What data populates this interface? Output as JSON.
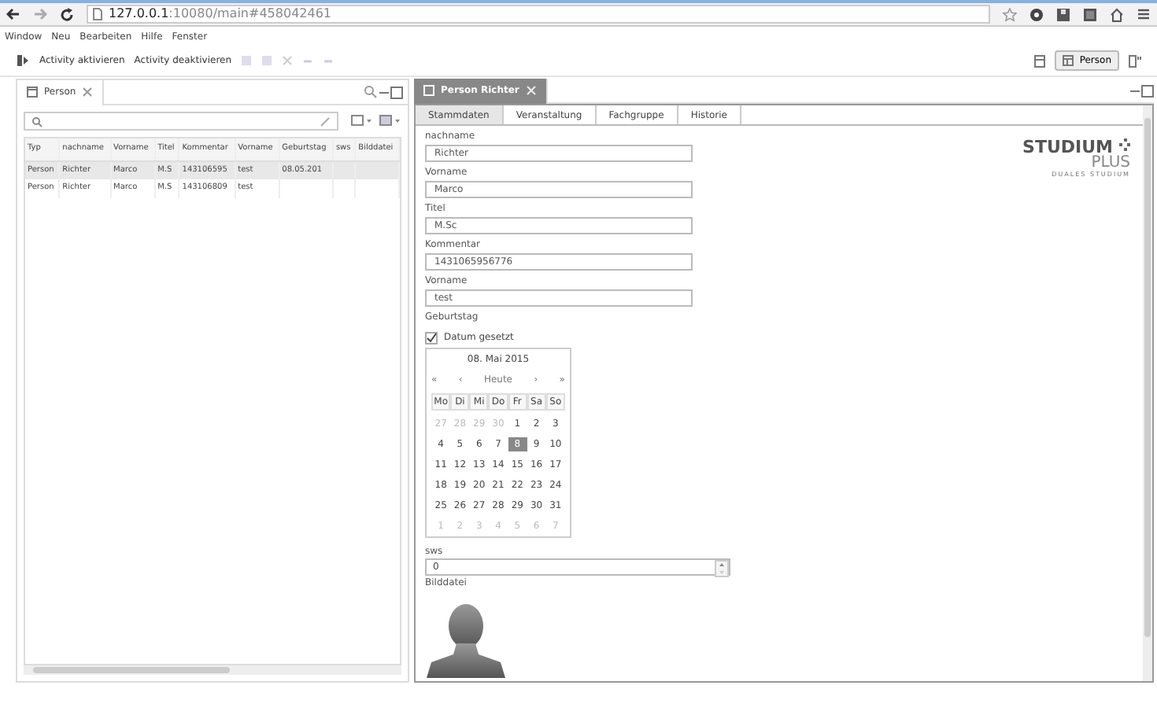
{
  "browser": {
    "url_host": "127.0.0.1",
    "url_rest": ":10080/main#458042461"
  },
  "menu": [
    "Window",
    "Neu",
    "Bearbeiten",
    "Hilfe",
    "Fenster"
  ],
  "toolbar": {
    "actions": [
      {
        "label": "Activity aktivieren",
        "disabled": false
      },
      {
        "label": "Activity deaktivieren",
        "disabled": false
      }
    ],
    "perspective": "Person"
  },
  "left_panel": {
    "tab": "Person",
    "table": {
      "columns": [
        "Typ",
        "nachname",
        "Vorname",
        "Titel",
        "Kommentar",
        "Vorname",
        "Geburtstag",
        "sws",
        "Bilddatei"
      ],
      "rows": [
        {
          "selected": true,
          "cells": [
            "Person",
            "Richter",
            "Marco",
            "M.S",
            "143106595",
            "test",
            "08.05.201",
            "",
            ""
          ]
        },
        {
          "selected": false,
          "cells": [
            "Person",
            "Richter",
            "Marco",
            "M.S",
            "143106809",
            "test",
            "",
            "",
            ""
          ]
        }
      ]
    }
  },
  "right_panel": {
    "tab": "Person Richter",
    "subtabs": [
      {
        "label": "Stammdaten",
        "selected": true
      },
      {
        "label": "Veranstaltung",
        "selected": false
      },
      {
        "label": "Fachgruppe",
        "selected": false
      },
      {
        "label": "Historie",
        "selected": false
      }
    ],
    "logo": {
      "line1": "STUDIUM",
      "line2": "PLUS",
      "line3": "DUALES STUDIUM"
    },
    "fields": [
      {
        "label": "nachname",
        "value": "Richter"
      },
      {
        "label": "Vorname",
        "value": "Marco"
      },
      {
        "label": "Titel",
        "value": "M.Sc"
      },
      {
        "label": "Kommentar",
        "value": "1431065956776"
      },
      {
        "label": "Vorname",
        "value": "test"
      }
    ],
    "birthday": {
      "label": "Geburtstag",
      "checkbox": {
        "label": "Datum gesetzt",
        "checked": true
      },
      "calendar": {
        "title": "08. Mai 2015",
        "nav": [
          "«",
          "‹",
          "Heute",
          "›",
          "»"
        ],
        "weekdays": [
          "Mo",
          "Di",
          "Mi",
          "Do",
          "Fr",
          "Sa",
          "So"
        ],
        "weeks": [
          [
            {
              "d": "27",
              "muted": true,
              "selected": false
            },
            {
              "d": "28",
              "muted": true,
              "selected": false
            },
            {
              "d": "29",
              "muted": true,
              "selected": false
            },
            {
              "d": "30",
              "muted": true,
              "selected": false
            },
            {
              "d": "1",
              "muted": false,
              "selected": false
            },
            {
              "d": "2",
              "muted": false,
              "selected": false
            },
            {
              "d": "3",
              "muted": false,
              "selected": false
            }
          ],
          [
            {
              "d": "4",
              "muted": false,
              "selected": false
            },
            {
              "d": "5",
              "muted": false,
              "selected": false
            },
            {
              "d": "6",
              "muted": false,
              "selected": false
            },
            {
              "d": "7",
              "muted": false,
              "selected": false
            },
            {
              "d": "8",
              "muted": false,
              "selected": true
            },
            {
              "d": "9",
              "muted": false,
              "selected": false
            },
            {
              "d": "10",
              "muted": false,
              "selected": false
            }
          ],
          [
            {
              "d": "11",
              "muted": false,
              "selected": false
            },
            {
              "d": "12",
              "muted": false,
              "selected": false
            },
            {
              "d": "13",
              "muted": false,
              "selected": false
            },
            {
              "d": "14",
              "muted": false,
              "selected": false
            },
            {
              "d": "15",
              "muted": false,
              "selected": false
            },
            {
              "d": "16",
              "muted": false,
              "selected": false
            },
            {
              "d": "17",
              "muted": false,
              "selected": false
            }
          ],
          [
            {
              "d": "18",
              "muted": false,
              "selected": false
            },
            {
              "d": "19",
              "muted": false,
              "selected": false
            },
            {
              "d": "20",
              "muted": false,
              "selected": false
            },
            {
              "d": "21",
              "muted": false,
              "selected": false
            },
            {
              "d": "22",
              "muted": false,
              "selected": false
            },
            {
              "d": "23",
              "muted": false,
              "selected": false
            },
            {
              "d": "24",
              "muted": false,
              "selected": false
            }
          ],
          [
            {
              "d": "25",
              "muted": false,
              "selected": false
            },
            {
              "d": "26",
              "muted": false,
              "selected": false
            },
            {
              "d": "27",
              "muted": false,
              "selected": false
            },
            {
              "d": "28",
              "muted": false,
              "selected": false
            },
            {
              "d": "29",
              "muted": false,
              "selected": false
            },
            {
              "d": "30",
              "muted": false,
              "selected": false
            },
            {
              "d": "31",
              "muted": false,
              "selected": false
            }
          ],
          [
            {
              "d": "1",
              "muted": true,
              "selected": false
            },
            {
              "d": "2",
              "muted": true,
              "selected": false
            },
            {
              "d": "3",
              "muted": true,
              "selected": false
            },
            {
              "d": "4",
              "muted": true,
              "selected": false
            },
            {
              "d": "5",
              "muted": true,
              "selected": false
            },
            {
              "d": "6",
              "muted": true,
              "selected": false
            },
            {
              "d": "7",
              "muted": true,
              "selected": false
            }
          ]
        ]
      }
    },
    "sws": {
      "label": "sws",
      "value": "0"
    },
    "image": {
      "label": "Bilddatei"
    }
  }
}
